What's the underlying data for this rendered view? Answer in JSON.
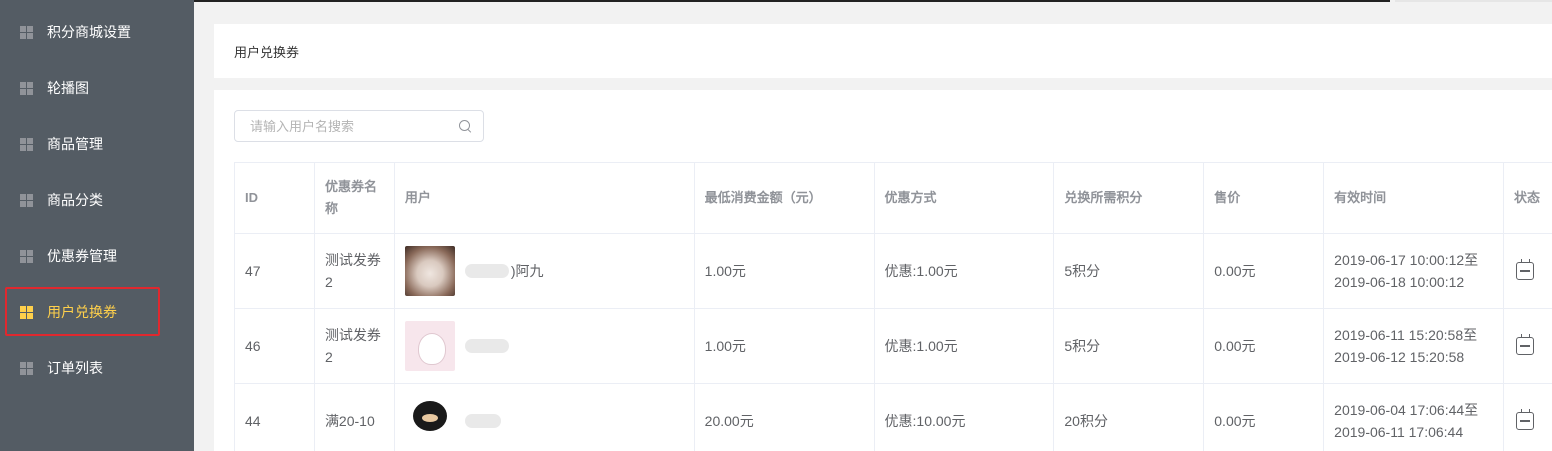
{
  "sidebar": {
    "items": [
      {
        "label": "积分商城设置",
        "active": false
      },
      {
        "label": "轮播图",
        "active": false
      },
      {
        "label": "商品管理",
        "active": false
      },
      {
        "label": "商品分类",
        "active": false
      },
      {
        "label": "优惠券管理",
        "active": false
      },
      {
        "label": "用户兑换券",
        "active": true
      },
      {
        "label": "订单列表",
        "active": false
      }
    ],
    "active_color": "#ffd04b",
    "background": "#545c64"
  },
  "header": {
    "title": "用户兑换券"
  },
  "search": {
    "placeholder": "请输入用户名搜索"
  },
  "table": {
    "columns": [
      "ID",
      "优惠券名称",
      "用户",
      "最低消费金额（元）",
      "优惠方式",
      "兑换所需积分",
      "售价",
      "有效时间",
      "状态"
    ],
    "rows": [
      {
        "id": "47",
        "name": "测试发券2",
        "user": ")阿九",
        "min": "1.00元",
        "way": "优惠:1.00元",
        "points": "5积分",
        "price": "0.00元",
        "time_start": "2019-06-17 10:00:12至",
        "time_end": "2019-06-18 10:00:12",
        "avatar": "cat-avatar"
      },
      {
        "id": "46",
        "name": "测试发券2",
        "user": "",
        "min": "1.00元",
        "way": "优惠:1.00元",
        "points": "5积分",
        "price": "0.00元",
        "time_start": "2019-06-11 15:20:58至",
        "time_end": "2019-06-12 15:20:58",
        "avatar": "moomin-avatar"
      },
      {
        "id": "44",
        "name": "满20-10",
        "user": "",
        "min": "20.00元",
        "way": "优惠:10.00元",
        "points": "20积分",
        "price": "0.00元",
        "time_start": "2019-06-04 17:06:44至",
        "time_end": "2019-06-11 17:06:44",
        "avatar": "bear-avatar"
      }
    ]
  },
  "icons": {
    "nav": "grid-icon",
    "search": "search-icon",
    "status": "calendar-icon"
  }
}
